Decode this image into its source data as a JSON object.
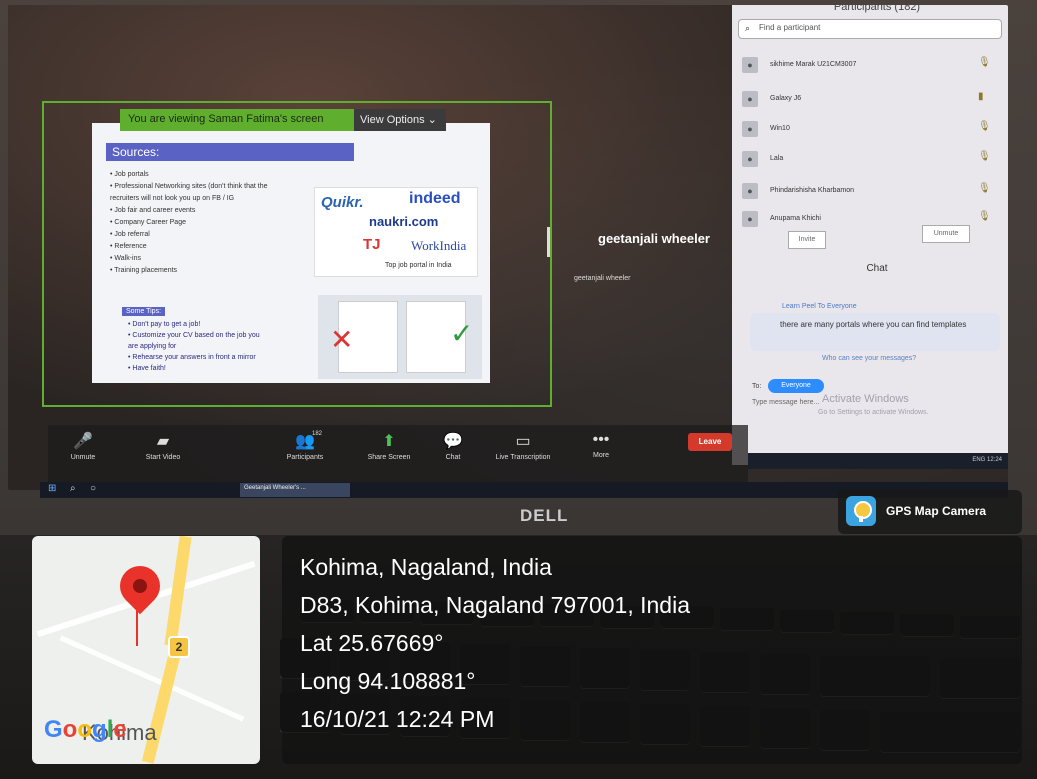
{
  "zoom": {
    "share_banner": "You are viewing Saman Fatima's screen",
    "view_options": "View Options ⌄",
    "speaker_name": "geetanjali wheeler",
    "speaker_small": "geetanjali wheeler",
    "slide": {
      "heading": "Sources:",
      "bullets": [
        "• Job portals",
        "• Professional Networking sites (don't think that the",
        "  recruiters will not look you up on FB / IG",
        "• Job fair and career events",
        "• Company Career Page",
        "• Job referral",
        "• Reference",
        "• Walk-ins",
        "• Training placements"
      ],
      "tips_title": "Some Tips:",
      "tips": [
        "• Don't pay to get a job!",
        "• Customize your CV based on the job you",
        "  are applying for",
        "• Rehearse your answers in front a mirror",
        "• Have faith!"
      ],
      "logos": {
        "quikr": "Quikr.",
        "indeed": "indeed",
        "naukri": "naukri.com",
        "workindia": "WorkIndia",
        "tj": "TJ"
      },
      "logos_caption": "Top job portal in India"
    },
    "participants_panel": {
      "title": "Participants (182)",
      "search_placeholder": "Find a participant",
      "participants": [
        {
          "name": "sikhime Marak U21CM3007"
        },
        {
          "name": "Galaxy J6"
        },
        {
          "name": "Win10"
        },
        {
          "name": "Lala"
        },
        {
          "name": "Phindarishisha Kharbamon"
        },
        {
          "name": "Anupama Khichi"
        }
      ],
      "invite": "Invite",
      "unmute": "Unmute",
      "chat_title": "Chat",
      "chat_sender": "Learn Peel To Everyone",
      "chat_message": "there are many portals where you can find templates",
      "chat_note": "Who can see your messages?",
      "to_label": "To:",
      "to_value": "Everyone",
      "type_placeholder": "Type message here...",
      "activate_title": "Activate Windows",
      "activate_sub": "Go to Settings to activate Windows."
    },
    "toolbar": {
      "unmute": "Unmute",
      "start_video": "Start Video",
      "participants": "Participants",
      "participant_count": "182",
      "share_screen": "Share Screen",
      "chat": "Chat",
      "live_transcription": "Live Transcription",
      "more": "More",
      "leave": "Leave"
    },
    "taskbar_app": "Geetanjali Wheeler's ...",
    "tray_text": "ENG 12:24"
  },
  "laptop_brand": "DELL",
  "gps": {
    "app_name": "GPS Map Camera",
    "route_number": "2",
    "map_town": "Kohima",
    "map_brand": "Google",
    "city": "Kohima, Nagaland, India",
    "address": "D83, Kohima, Nagaland 797001, India",
    "lat": "Lat 25.67669°",
    "long": "Long 94.108881°",
    "datetime": "16/10/21 12:24 PM"
  },
  "colors": {
    "share_green": "#5fae2e",
    "leave_red": "#d43a2c",
    "pin_red": "#e8322a",
    "route_yellow": "#f6c443"
  }
}
